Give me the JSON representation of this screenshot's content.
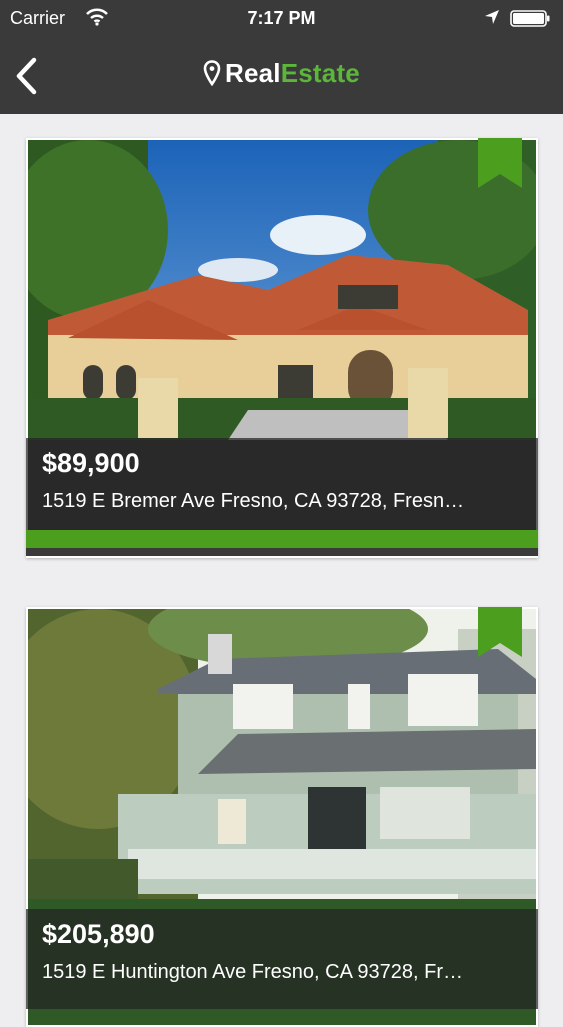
{
  "status_bar": {
    "carrier": "Carrier",
    "time": "7:17 PM",
    "wifi_icon": "wifi-icon",
    "location_icon": "location-arrow-icon",
    "battery_icon": "battery-icon"
  },
  "navbar": {
    "back_icon": "chevron-left-icon",
    "logo_icon": "map-pin-icon",
    "brand_white": "Real",
    "brand_green": "Estate"
  },
  "colors": {
    "header_bg": "#3a3a3a",
    "accent_green": "#5bb63a",
    "bar_green": "#4c9e1f",
    "page_bg": "#eeeef0"
  },
  "listings": [
    {
      "price": "$89,900",
      "address": "1519 E Bremer Ave Fresno, CA 93728, Fresn…",
      "bookmark_icon": "bookmark-ribbon-icon"
    },
    {
      "price": "$205,890",
      "address": "1519 E Huntington Ave Fresno, CA 93728, Fr…",
      "bookmark_icon": "bookmark-ribbon-icon"
    }
  ]
}
